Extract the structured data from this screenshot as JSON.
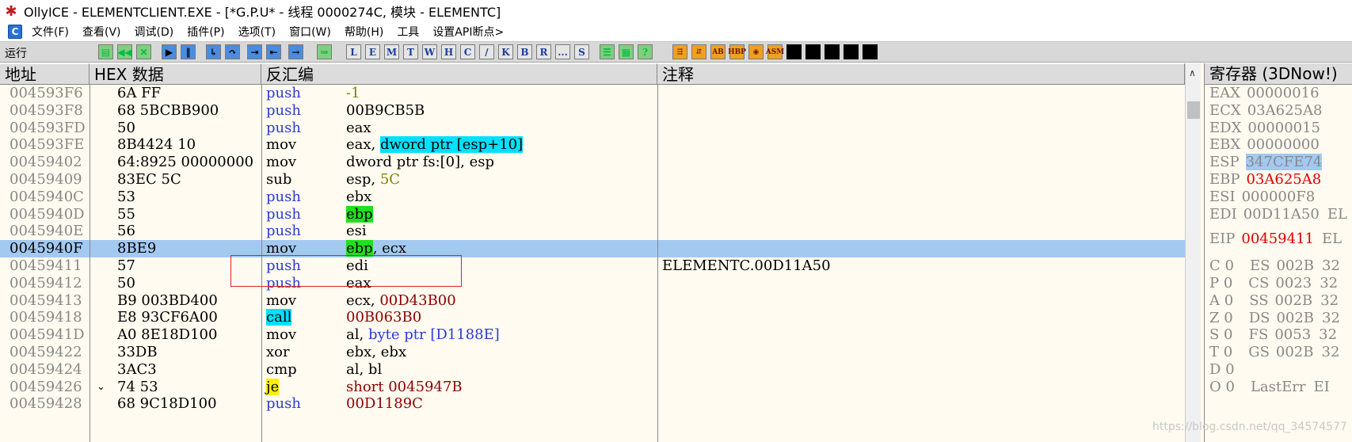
{
  "window": {
    "title": "OllyICE - ELEMENTCLIENT.EXE - [*G.P.U* -  线程  0000274C, 模块 - ELEMENTC]"
  },
  "menu": [
    "文件(F)",
    "查看(V)",
    "调试(D)",
    "插件(P)",
    "选项(T)",
    "窗口(W)",
    "帮助(H)",
    "工具",
    "设置API断点>"
  ],
  "toolbar": {
    "status": "运行",
    "letters": [
      "L",
      "E",
      "M",
      "T",
      "W",
      "H",
      "C",
      "/",
      "K",
      "B",
      "R",
      "...",
      "S"
    ]
  },
  "columns": {
    "addr": "地址",
    "hex": "HEX 数据",
    "disasm": "反汇编",
    "comment": "注释"
  },
  "rows": [
    {
      "addr": "004593F6",
      "hex": "6A FF",
      "mnem": "push",
      "op": "-1",
      "comment": ""
    },
    {
      "addr": "004593F8",
      "hex": "68 5BCBB900",
      "mnem": "push",
      "op": "00B9CB5B",
      "comment": ""
    },
    {
      "addr": "004593FD",
      "hex": "50",
      "mnem": "push",
      "op": "eax",
      "comment": ""
    },
    {
      "addr": "004593FE",
      "hex": "8B4424 10",
      "mnem": "mov",
      "op_pre": "eax, ",
      "op_hl": "dword ptr [esp+10]",
      "comment": ""
    },
    {
      "addr": "00459402",
      "hex": "64:8925 00000000",
      "mnem": "mov",
      "op": "dword ptr fs:[0], esp",
      "comment": ""
    },
    {
      "addr": "00459409",
      "hex": "83EC 5C",
      "mnem": "sub",
      "op_pre": "esp, ",
      "op_num": "5C",
      "comment": ""
    },
    {
      "addr": "0045940C",
      "hex": "53",
      "mnem": "push",
      "op": "ebx",
      "comment": ""
    },
    {
      "addr": "0045940D",
      "hex": "55",
      "mnem": "push",
      "op_hl": "ebp",
      "comment": ""
    },
    {
      "addr": "0045940E",
      "hex": "56",
      "mnem": "push",
      "op": "esi",
      "comment": ""
    },
    {
      "addr": "0045940F",
      "hex": "8BE9",
      "mnem": "mov",
      "op_hl": "ebp",
      "op_post": ", ecx",
      "comment": ""
    },
    {
      "addr": "00459411",
      "hex": "57",
      "mnem": "push",
      "op": "edi",
      "comment": "ELEMENTC.00D11A50"
    },
    {
      "addr": "00459412",
      "hex": "50",
      "mnem": "push",
      "op": "eax",
      "comment": ""
    },
    {
      "addr": "00459413",
      "hex": "B9 003BD400",
      "mnem": "mov",
      "op_pre": "ecx, ",
      "op_addr": "00D43B00",
      "comment": ""
    },
    {
      "addr": "00459418",
      "hex": "E8 93CF6A00",
      "mnem": "call",
      "op_addr": "00B063B0",
      "comment": ""
    },
    {
      "addr": "0045941D",
      "hex": "A0 8E18D100",
      "mnem": "mov",
      "op_pre": "al, ",
      "op_kw": "byte ptr [D1188E]",
      "comment": ""
    },
    {
      "addr": "00459422",
      "hex": "33DB",
      "mnem": "xor",
      "op": "ebx, ebx",
      "comment": ""
    },
    {
      "addr": "00459424",
      "hex": "3AC3",
      "mnem": "cmp",
      "op": "al, bl",
      "comment": ""
    },
    {
      "addr": "00459426",
      "hex": "74 53",
      "mnem": "je",
      "op_addr": "short 0045947B",
      "comment": "",
      "arrow": "⌄"
    },
    {
      "addr": "00459428",
      "hex": "68 9C18D100",
      "mnem": "push",
      "op_addr": "00D1189C",
      "comment": ""
    }
  ],
  "registers": {
    "header": "寄存器 (3DNow!)",
    "gp": [
      {
        "name": "EAX",
        "value": "00000016"
      },
      {
        "name": "ECX",
        "value": "03A625A8"
      },
      {
        "name": "EDX",
        "value": "00000015"
      },
      {
        "name": "EBX",
        "value": "00000000"
      },
      {
        "name": "ESP",
        "value": "347CFE74"
      },
      {
        "name": "EBP",
        "value": "03A625A8"
      },
      {
        "name": "ESI",
        "value": "000000F8"
      },
      {
        "name": "EDI",
        "value": "00D11A50",
        "ext": "EL"
      }
    ],
    "eip": {
      "name": "EIP",
      "value": "00459411",
      "ext": "EL"
    },
    "flags": [
      {
        "flag": "C 0",
        "seg": "ES",
        "val": "002B",
        "ext": "32"
      },
      {
        "flag": "P 0",
        "seg": "CS",
        "val": "0023",
        "ext": "32"
      },
      {
        "flag": "A 0",
        "seg": "SS",
        "val": "002B",
        "ext": "32"
      },
      {
        "flag": "Z 0",
        "seg": "DS",
        "val": "002B",
        "ext": "32"
      },
      {
        "flag": "S 0",
        "seg": "FS",
        "val": "0053",
        "ext": "32"
      },
      {
        "flag": "T 0",
        "seg": "GS",
        "val": "002B",
        "ext": "32"
      },
      {
        "flag": "D 0",
        "seg": "",
        "val": "",
        "ext": ""
      },
      {
        "flag": "O 0",
        "seg": "LastErr",
        "val": "",
        "ext": "EI"
      }
    ]
  },
  "watermark": "https://blog.csdn.net/qq_34574577",
  "colors": {
    "selection": "#a3c9f0",
    "cyan": "#00e0ff",
    "green": "#20e020",
    "yellow": "#ffef00",
    "panel_bg": "#fffbf0"
  }
}
